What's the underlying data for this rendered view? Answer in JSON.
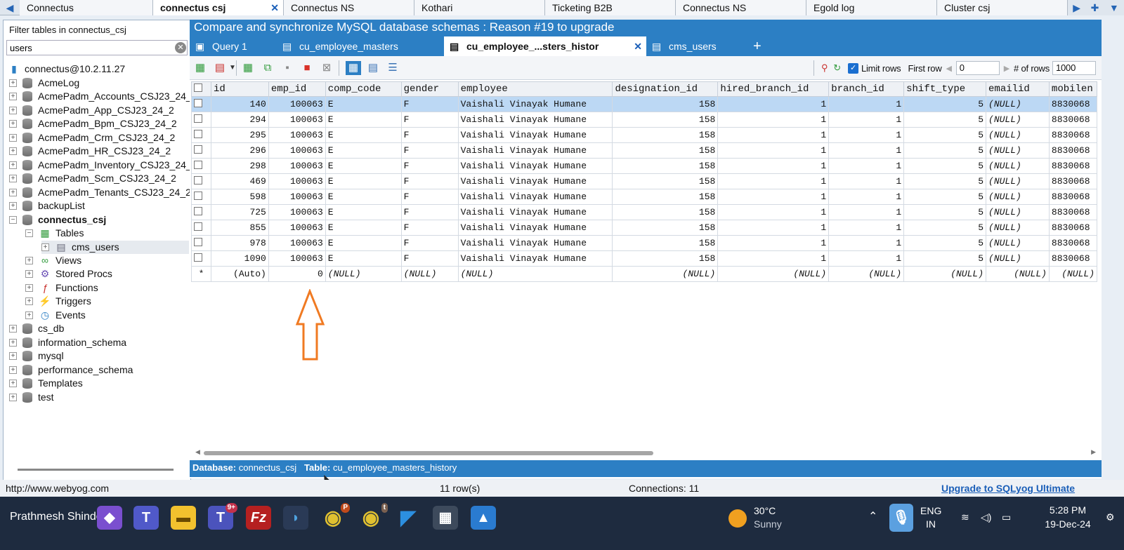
{
  "conn_tabs": [
    {
      "label": "Connectus",
      "active": false
    },
    {
      "label": "connectus csj",
      "active": true
    },
    {
      "label": "Connectus NS",
      "active": false
    },
    {
      "label": "Kothari",
      "active": false
    },
    {
      "label": "Ticketing B2B",
      "active": false
    },
    {
      "label": "Connectus NS",
      "active": false
    },
    {
      "label": "Egold log",
      "active": false
    },
    {
      "label": "Cluster csj",
      "active": false
    }
  ],
  "filter": {
    "label": "Filter tables in connectus_csj",
    "value": "users"
  },
  "tree": {
    "connection": "connectus@10.2.11.27",
    "databases_top": [
      "AcmeLog",
      "AcmePadm_Accounts_CSJ23_24_2",
      "AcmePadm_App_CSJ23_24_2",
      "AcmePadm_Bpm_CSJ23_24_2",
      "AcmePadm_Crm_CSJ23_24_2",
      "AcmePadm_HR_CSJ23_24_2",
      "AcmePadm_Inventory_CSJ23_24_2",
      "AcmePadm_Scm_CSJ23_24_2",
      "AcmePadm_Tenants_CSJ23_24_2",
      "backupList"
    ],
    "current_db": "connectus_csj",
    "tables_label": "Tables",
    "table_item": "cms_users",
    "views": "Views",
    "procs": "Stored Procs",
    "functions": "Functions",
    "triggers": "Triggers",
    "events": "Events",
    "databases_bottom": [
      "cs_db",
      "information_schema",
      "mysql",
      "performance_schema",
      "Templates",
      "test"
    ]
  },
  "banner": "Compare and synchronize MySQL database schemas : Reason #19 to upgrade",
  "query_tabs": [
    {
      "label": "Query 1",
      "icon": "query-icon",
      "active": false
    },
    {
      "label": "cu_employee_masters",
      "icon": "table-icon",
      "active": false
    },
    {
      "label": "cu_employee_...sters_histor",
      "icon": "table-icon",
      "active": true
    },
    {
      "label": "cms_users",
      "icon": "table-icon",
      "active": false
    }
  ],
  "toolbar": {
    "limit_label": "Limit rows",
    "first_row_label": "First row",
    "first_row_value": "0",
    "num_rows_label": "# of rows",
    "num_rows_value": "1000"
  },
  "grid": {
    "columns": [
      "id",
      "emp_id",
      "comp_code",
      "gender",
      "employee",
      "designation_id",
      "hired_branch_id",
      "branch_id",
      "shift_type",
      "emailid",
      "mobilen"
    ],
    "rows": [
      [
        "140",
        "100063",
        "E",
        "F",
        "Vaishali Vinayak Humane",
        "158",
        "1",
        "1",
        "5",
        "(NULL)",
        "8830068"
      ],
      [
        "294",
        "100063",
        "E",
        "F",
        "Vaishali Vinayak Humane",
        "158",
        "1",
        "1",
        "5",
        "(NULL)",
        "8830068"
      ],
      [
        "295",
        "100063",
        "E",
        "F",
        "Vaishali Vinayak Humane",
        "158",
        "1",
        "1",
        "5",
        "(NULL)",
        "8830068"
      ],
      [
        "296",
        "100063",
        "E",
        "F",
        "Vaishali Vinayak Humane",
        "158",
        "1",
        "1",
        "5",
        "(NULL)",
        "8830068"
      ],
      [
        "298",
        "100063",
        "E",
        "F",
        "Vaishali Vinayak Humane",
        "158",
        "1",
        "1",
        "5",
        "(NULL)",
        "8830068"
      ],
      [
        "469",
        "100063",
        "E",
        "F",
        "Vaishali Vinayak Humane",
        "158",
        "1",
        "1",
        "5",
        "(NULL)",
        "8830068"
      ],
      [
        "598",
        "100063",
        "E",
        "F",
        "Vaishali Vinayak Humane",
        "158",
        "1",
        "1",
        "5",
        "(NULL)",
        "8830068"
      ],
      [
        "725",
        "100063",
        "E",
        "F",
        "Vaishali Vinayak Humane",
        "158",
        "1",
        "1",
        "5",
        "(NULL)",
        "8830068"
      ],
      [
        "855",
        "100063",
        "E",
        "F",
        "Vaishali Vinayak Humane",
        "158",
        "1",
        "1",
        "5",
        "(NULL)",
        "8830068"
      ],
      [
        "978",
        "100063",
        "E",
        "F",
        "Vaishali Vinayak Humane",
        "158",
        "1",
        "1",
        "5",
        "(NULL)",
        "8830068"
      ],
      [
        "1090",
        "100063",
        "E",
        "F",
        "Vaishali Vinayak Humane",
        "158",
        "1",
        "1",
        "5",
        "(NULL)",
        "8830068"
      ]
    ],
    "new_row": [
      "*",
      "(Auto)",
      "0",
      "(NULL)",
      "(NULL)",
      "(NULL)",
      "(NULL)",
      "(NULL)",
      "(NULL)",
      "(NULL)",
      "(NULL)",
      "(NULL)"
    ]
  },
  "info_bar": {
    "db_label": "Database:",
    "db_value": "connectus_csj",
    "table_label": "Table:",
    "table_value": "cu_employee_masters_history"
  },
  "status": {
    "url": "http://www.webyog.com",
    "rows": "11 row(s)",
    "connections": "Connections: 11",
    "upgrade": "Upgrade to SQLyog Ultimate"
  },
  "taskbar": {
    "user": "Prathmesh Shinde",
    "teams_badge": "9+",
    "chrome_badge_1": "P",
    "chrome_badge_2": "t",
    "temp": "30°C",
    "weather": "Sunny",
    "lang_1": "ENG",
    "lang_2": "IN",
    "time": "5:28 PM",
    "date": "19-Dec-24"
  },
  "colors": {
    "accent": "#2c7fc4",
    "selected_row": "#bcd8f4",
    "arrow": "#f07a22"
  }
}
